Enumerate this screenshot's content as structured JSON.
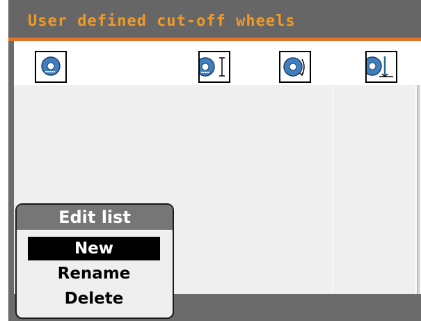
{
  "window": {
    "title": "User defined cut-off wheels"
  },
  "columns": [
    {
      "icon": "cutoff-wheel-icon"
    },
    {
      "icon": "wheel-diameter-icon"
    },
    {
      "icon": "wheel-rotation-icon"
    },
    {
      "icon": "wheel-depth-icon"
    }
  ],
  "popup": {
    "title": "Edit list",
    "items": [
      {
        "label": "New",
        "selected": true
      },
      {
        "label": "Rename",
        "selected": false
      },
      {
        "label": "Delete",
        "selected": false
      }
    ]
  },
  "colors": {
    "title_text": "#f29a26",
    "accent_line": "#e6732a",
    "wheel_blue": "#3f7fc0",
    "background": "#6b6b6b"
  }
}
